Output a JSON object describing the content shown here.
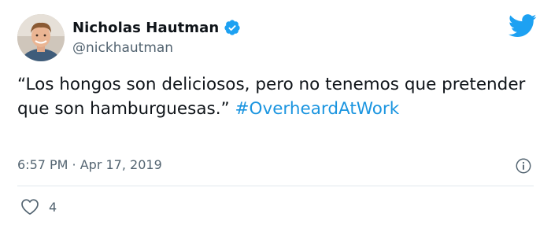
{
  "author": {
    "display_name": "Nicholas Hautman",
    "handle": "@nickhautman",
    "verified": true,
    "avatar_icon": "profile-photo"
  },
  "tweet": {
    "text_prefix": "“Los hongos son deliciosos, pero no tenemos que pretender que son hamburguesas.” ",
    "hashtag": "#OverheardAtWork",
    "timestamp": "6:57 PM · Apr 17, 2019"
  },
  "engagement": {
    "likes": "4"
  },
  "icons": {
    "brand": "twitter-bird-icon",
    "info": "info-icon",
    "like": "heart-icon",
    "verified": "verified-badge-icon"
  },
  "colors": {
    "accent": "#1da1f2",
    "hashtag": "#1b95e0",
    "secondary_text": "#536471",
    "divider": "#e1e8ed"
  }
}
